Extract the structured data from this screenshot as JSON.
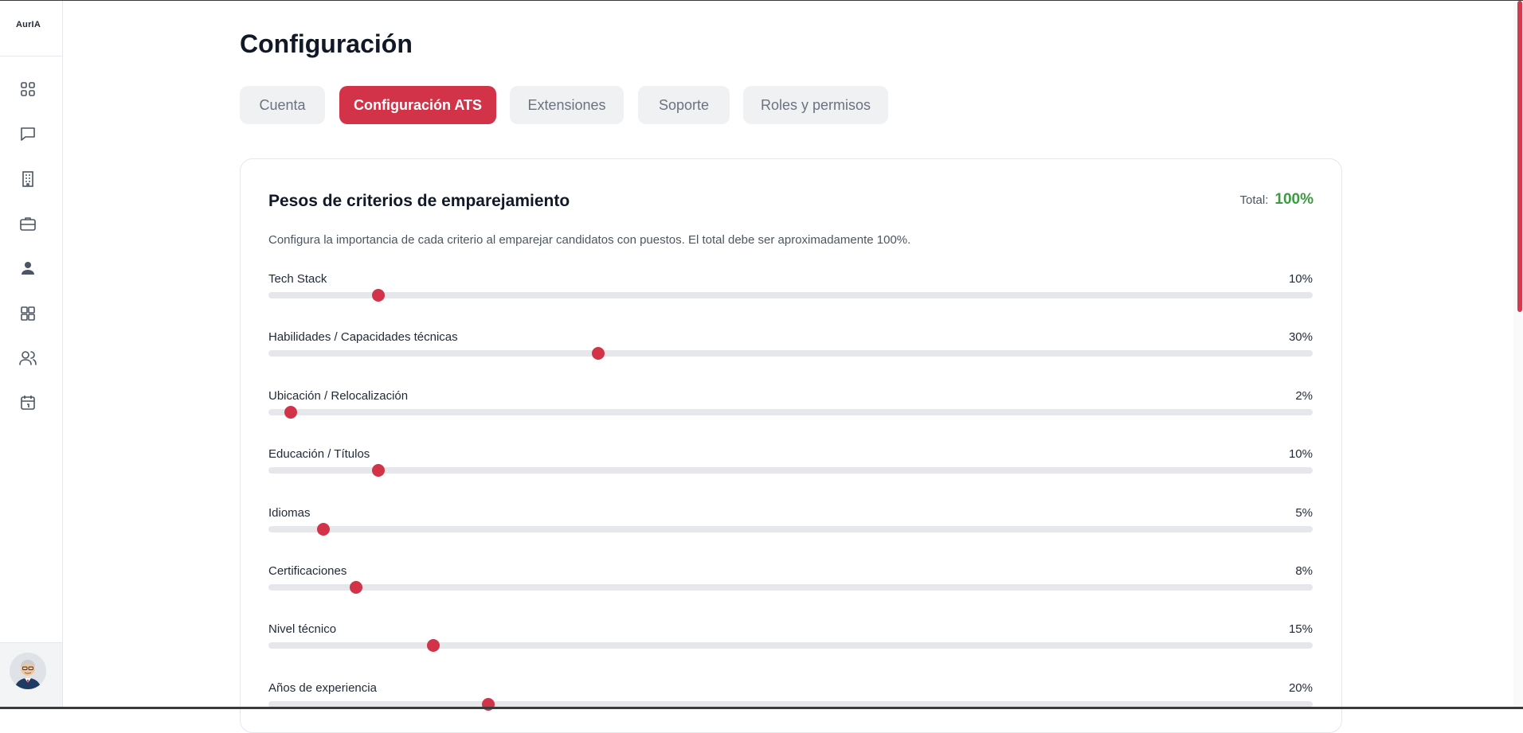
{
  "app": {
    "logo": "AurIA"
  },
  "sidebar": {
    "items": [
      {
        "icon": "dashboard-grid-icon"
      },
      {
        "icon": "chat-icon"
      },
      {
        "icon": "building-icon"
      },
      {
        "icon": "briefcase-icon"
      },
      {
        "icon": "person-icon"
      },
      {
        "icon": "apps-grid-icon"
      },
      {
        "icon": "users-icon"
      },
      {
        "icon": "calendar-icon"
      }
    ],
    "avatar": "user-avatar"
  },
  "page": {
    "title": "Configuración"
  },
  "tabs": [
    {
      "label": "Cuenta",
      "active": false
    },
    {
      "label": "Configuración ATS",
      "active": true
    },
    {
      "label": "Extensiones",
      "active": false
    },
    {
      "label": "Soporte",
      "active": false
    },
    {
      "label": "Roles y permisos",
      "active": false
    }
  ],
  "card": {
    "title": "Pesos de criterios de emparejamiento",
    "total_label": "Total:",
    "total_value": "100%",
    "description": "Configura la importancia de cada criterio al emparejar candidatos con puestos. El total debe ser aproximadamente 100%.",
    "criteria": [
      {
        "label": "Tech Stack",
        "value": 10,
        "display": "10%"
      },
      {
        "label": "Habilidades / Capacidades técnicas",
        "value": 30,
        "display": "30%"
      },
      {
        "label": "Ubicación / Relocalización",
        "value": 2,
        "display": "2%"
      },
      {
        "label": "Educación / Títulos",
        "value": 10,
        "display": "10%"
      },
      {
        "label": "Idiomas",
        "value": 5,
        "display": "5%"
      },
      {
        "label": "Certificaciones",
        "value": 8,
        "display": "8%"
      },
      {
        "label": "Nivel técnico",
        "value": 15,
        "display": "15%"
      },
      {
        "label": "Años de experiencia",
        "value": 20,
        "display": "20%"
      }
    ],
    "slider_max": 95
  },
  "colors": {
    "accent": "#d23349",
    "total_green": "#3d9a42",
    "track": "#e5e7eb",
    "tab_bg": "#f0f1f3"
  }
}
